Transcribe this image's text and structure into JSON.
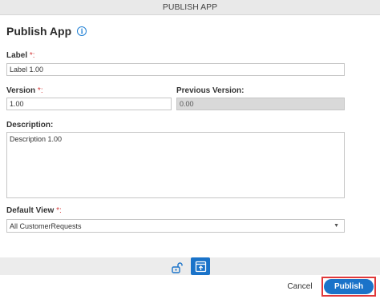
{
  "window": {
    "title": "PUBLISH APP"
  },
  "header": {
    "title": "Publish App",
    "info_icon": "info-icon"
  },
  "form": {
    "label": {
      "label": "Label",
      "required_mark": "*:",
      "value": "Label 1.00"
    },
    "version": {
      "label": "Version",
      "required_mark": "*:",
      "value": "1.00"
    },
    "previous_version": {
      "label": "Previous Version:",
      "value": "0.00"
    },
    "description": {
      "label": "Description:",
      "value": "Description 1.00"
    },
    "default_view": {
      "label": "Default View",
      "required_mark": "*:",
      "value": "All CustomerRequests",
      "caret": "▼"
    }
  },
  "toolbar": {
    "lock_icon": "unlock-icon",
    "view_icon": "publish-view-icon",
    "accent": "#1a73c9"
  },
  "footer": {
    "cancel_label": "Cancel",
    "publish_label": "Publish",
    "highlight_color": "#e0383a"
  }
}
